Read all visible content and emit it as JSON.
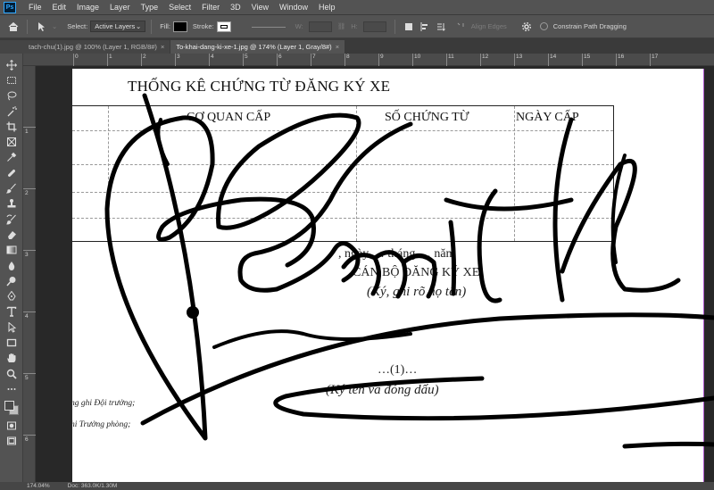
{
  "app": {
    "logo": "Ps",
    "menu": [
      "File",
      "Edit",
      "Image",
      "Layer",
      "Type",
      "Select",
      "Filter",
      "3D",
      "View",
      "Window",
      "Help"
    ]
  },
  "options": {
    "select_label": "Select:",
    "select_value": "Active Layers",
    "fill_label": "Fill:",
    "stroke_label": "Stroke:",
    "w_label": "W:",
    "h_label": "H:",
    "align_edges": "Align Edges",
    "constrain": "Constrain Path Dragging"
  },
  "tabs": [
    {
      "label": "tach-chu(1).jpg @ 100% (Layer 1, RGB/8#)",
      "close": "×"
    },
    {
      "label": "To-khai-dang-ki-xe-1.jpg @ 174% (Layer 1, Gray/8#)",
      "close": "×"
    }
  ],
  "rulers": {
    "horizontal": [
      "0",
      "1",
      "2",
      "3",
      "4",
      "5",
      "6",
      "7",
      "8",
      "9",
      "10",
      "11",
      "12",
      "13",
      "14",
      "15",
      "16",
      "17"
    ],
    "vertical": [
      "1",
      "2",
      "3",
      "4",
      "5",
      "6"
    ]
  },
  "document": {
    "title": "THỐNG KÊ CHỨNG TỪ ĐĂNG KÝ XE",
    "columns": [
      "CƠ QUAN CẤP",
      "SỐ CHỨNG TỪ",
      "NGÀY CẤP"
    ],
    "date_line": ", ngày … tháng … năm",
    "signer_caption": "CÁN BỘ ĐĂNG KÝ XE",
    "sign_hint": "(Ký, ghi rõ họ tên)",
    "placeholder": "…(1)…",
    "seal_hint": "(Ký tên và đóng dấu)",
    "left_note_1": "ng ghi Đội trưởng;",
    "left_note_2": "hi Trưởng phòng;"
  },
  "status": {
    "zoom": "174.04%",
    "doc": "Doc: 363.0K/1.30M"
  }
}
